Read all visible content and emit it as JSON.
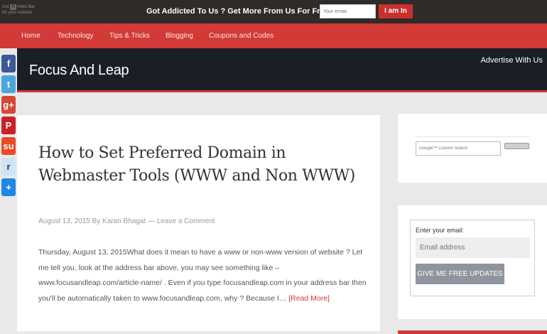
{
  "hellobar": {
    "brand_line1": "Get",
    "brand_badge": "H",
    "brand_line1b": "Hello Bar",
    "brand_line2": "for your website",
    "message": "Got Addicted To Us ? Get More From Us For Free",
    "email_placeholder": "Your email",
    "button_label": "I am In"
  },
  "nav": {
    "items": [
      {
        "label": "Home"
      },
      {
        "label": "Technology"
      },
      {
        "label": "Tips & Tricks"
      },
      {
        "label": "Blogging"
      },
      {
        "label": "Coupons and Codes"
      }
    ]
  },
  "header": {
    "site_title": "Focus And Leap",
    "advertise": "Advertise With Us"
  },
  "share": {
    "buttons": [
      {
        "icon": "facebook-icon",
        "glyph": "f",
        "color": "#3b5998"
      },
      {
        "icon": "twitter-icon",
        "glyph": "t",
        "color": "#4aa6dc"
      },
      {
        "icon": "google-plus-icon",
        "glyph": "g+",
        "color": "#d34836"
      },
      {
        "icon": "pinterest-icon",
        "glyph": "P",
        "color": "#cb2027"
      },
      {
        "icon": "stumbleupon-icon",
        "glyph": "su",
        "color": "#eb4924"
      },
      {
        "icon": "reddit-icon",
        "glyph": "r",
        "color": "#cee3f8"
      },
      {
        "icon": "share-plus-icon",
        "glyph": "+",
        "color": "#1e88e5"
      }
    ]
  },
  "post": {
    "title": "How to Set Preferred Domain in Webmaster Tools (WWW and Non WWW)",
    "meta_date": "August 13, 2015",
    "meta_by": "By",
    "meta_author": "Karan Bhagat",
    "meta_sep": "—",
    "meta_comment": "Leave a Comment",
    "excerpt": "Thursday, August 13, 2015What does it mean to have a www or non-www version of website ? Let me tell you, look at the address bar above, you may see something like – www.focusandleap.com/article-name/ . Even if you type focusandleap.com in your address bar then you'll be automatically taken to www.focusandleap.com, why ? Because I…",
    "read_more": "[Read More]"
  },
  "sidebar": {
    "search_placeholder": "Google™ Custom Search",
    "subscribe_label": "Enter your email:",
    "subscribe_placeholder": "Email address",
    "subscribe_button": "GIVE ME FREE UPDATES"
  },
  "colors": {
    "accent": "#d13a36",
    "header_bg": "#1a1e26",
    "hellobar_bg": "#2e2b28"
  }
}
